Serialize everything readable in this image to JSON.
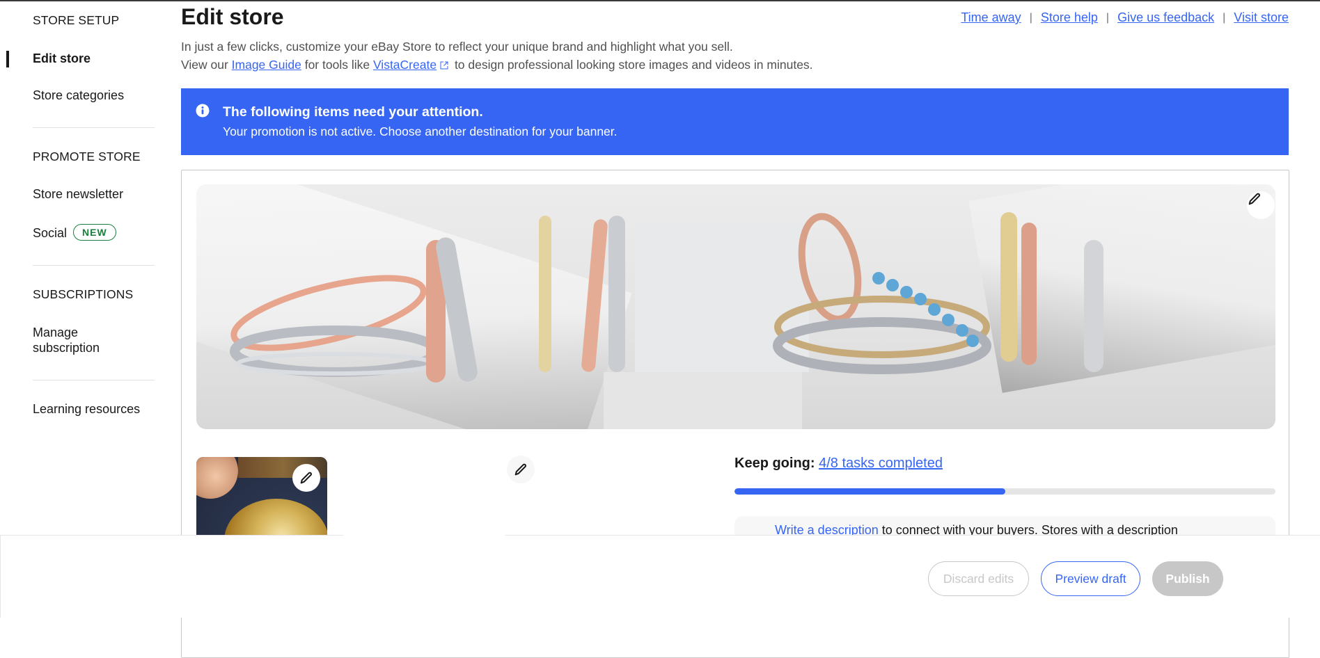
{
  "sidebar": {
    "sections": [
      {
        "heading": "STORE SETUP",
        "items": [
          {
            "label": "Edit store",
            "active": true
          },
          {
            "label": "Store categories"
          }
        ]
      },
      {
        "heading": "PROMOTE STORE",
        "items": [
          {
            "label": "Store newsletter"
          },
          {
            "label": "Social",
            "badge": "NEW"
          }
        ]
      },
      {
        "heading": "SUBSCRIPTIONS",
        "items": [
          {
            "label": "Manage subscription"
          }
        ]
      },
      {
        "heading": "",
        "items": [
          {
            "label": "Learning resources"
          }
        ]
      }
    ]
  },
  "header": {
    "title": "Edit store",
    "links": [
      "Time away",
      "Store help",
      "Give us feedback",
      "Visit store"
    ],
    "separator": "|",
    "description_line1": "In just a few clicks, customize your eBay Store to reflect your unique brand and highlight what you sell.",
    "description_line2": {
      "prefix": "View our ",
      "link1": "Image Guide",
      "middle": " for tools like ",
      "link2": "VistaCreate",
      "suffix": " to design professional looking store images and videos in minutes."
    }
  },
  "alert": {
    "icon": "info-icon",
    "title": "The following items need your attention.",
    "body": "Your promotion is not active. Choose another destination for your banner.",
    "color": "#3665f3"
  },
  "editor": {
    "banner_image": "rings-banner",
    "logo_image": "gold-ring-logo",
    "edit_icon": "pencil-icon"
  },
  "progress": {
    "label": "Keep going:",
    "link": "4/8 tasks completed",
    "completed": 4,
    "total": 8,
    "fraction": 0.5
  },
  "task": {
    "link": "Write a description",
    "text": " to connect with your buyers. Stores with a description"
  },
  "footer": {
    "discard_label": "Discard edits",
    "preview_label": "Preview draft",
    "publish_label": "Publish"
  },
  "colors": {
    "accent": "#3665f3",
    "badge_green": "#1a7f3c",
    "disabled": "#c7c7c7"
  }
}
